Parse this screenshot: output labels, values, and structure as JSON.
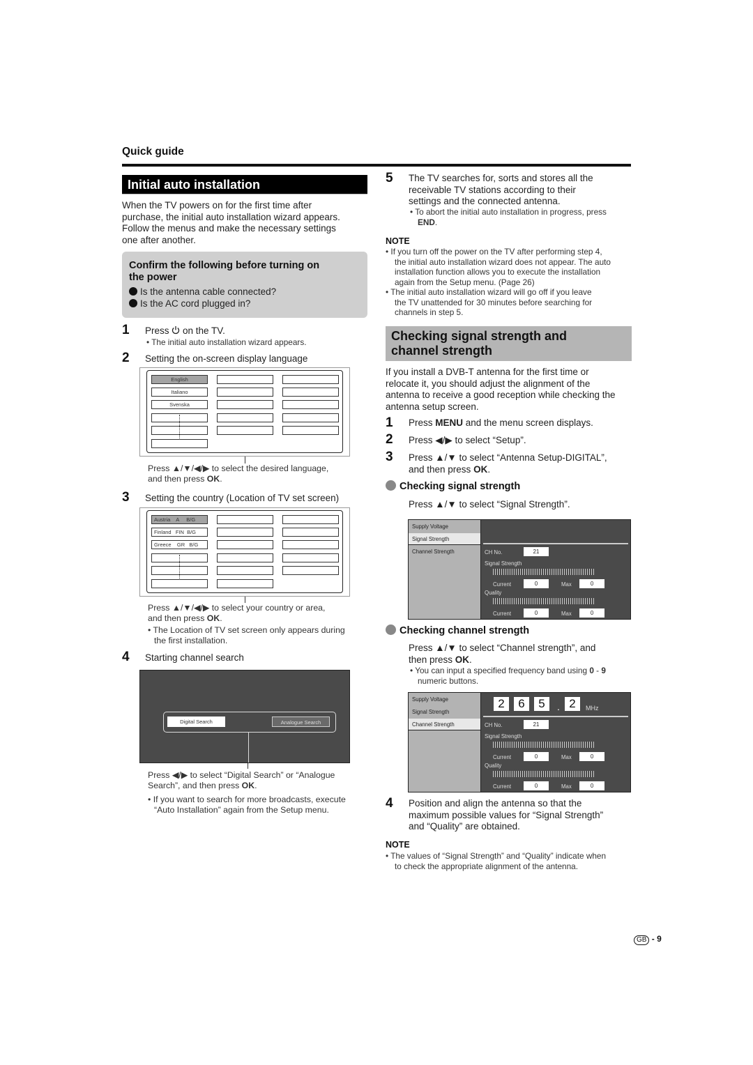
{
  "header": {
    "section": "Quick guide"
  },
  "left": {
    "title": "Initial auto installation",
    "intro": [
      "When the TV powers on for the first time after",
      "purchase, the initial auto installation wizard appears.",
      "Follow the menus and make the necessary settings",
      "one after another."
    ],
    "confirm_box": {
      "title_lines": [
        "Confirm the following  before turning on",
        "the power"
      ],
      "items": [
        "Is the antenna cable connected?",
        "Is the AC cord plugged in?"
      ]
    },
    "steps": [
      {
        "num": "1",
        "text_before": "Press ",
        "icon": "power-icon",
        "text_after": " on the TV.",
        "bullet": "The initial auto installation wizard appears."
      },
      {
        "num": "2",
        "text": "Setting the on-screen display language",
        "languages": [
          "English",
          "Italiano",
          "Svenska"
        ],
        "caption_line1": "Press ▲/▼/◀/▶ to select the desired language,",
        "caption_line2_pre": "and then press ",
        "caption_line2_bold": "OK",
        "caption_line2_post": "."
      },
      {
        "num": "3",
        "text": "Setting the country (Location of TV set screen)",
        "countries": [
          "Austria    A     B/G",
          "Finland   FIN  B/G",
          "Greece    GR   B/G"
        ],
        "caption_line1": "Press ▲/▼/◀/▶ to select your country or area,",
        "caption_line2_pre": "and then press ",
        "caption_line2_bold": "OK",
        "caption_line2_post": ".",
        "bullet_lines": [
          "The Location of TV set screen only appears during",
          "the first installation."
        ]
      },
      {
        "num": "4",
        "text": "Starting channel search",
        "buttons": {
          "digital": "Digital Search",
          "analogue": "Analogue Search"
        },
        "caption_line1": "Press ◀/▶ to select “Digital Search” or “Analogue",
        "caption_line2_pre": "Search”, and then press ",
        "caption_line2_bold": "OK",
        "caption_line2_post": ".",
        "bullet_lines": [
          "If you want to search for more broadcasts, execute",
          "“Auto Installation” again from the Setup menu."
        ]
      }
    ]
  },
  "right": {
    "step5": {
      "num": "5",
      "lines": [
        "The TV searches for, sorts and stores all the",
        "receivable TV stations according to their",
        "settings and the connected antenna."
      ],
      "bullet_line1": "To abort the initial auto installation in progress, press",
      "bullet_bold": "END",
      "bullet_post": "."
    },
    "note1": {
      "heading": "NOTE",
      "bullets": [
        [
          "If you turn off the power on the TV after performing step 4,",
          "the initial auto installation wizard does not appear. The auto",
          "installation function allows you to execute the installation",
          "again from the Setup menu. (Page 26)"
        ],
        [
          "The initial auto installation wizard will go off if you leave",
          "the TV unattended for 30 minutes before searching for",
          "channels in step 5."
        ]
      ]
    },
    "section2": {
      "title_lines": [
        "Checking signal strength and",
        "channel strength"
      ],
      "intro": [
        "If you install a DVB-T antenna for the first time or",
        "relocate it, you should adjust the alignment of the",
        "antenna to receive a good reception while checking the",
        "antenna setup screen."
      ],
      "steps": [
        {
          "num": "1",
          "pre": "Press ",
          "bold": "MENU",
          "post": " and the menu screen displays."
        },
        {
          "num": "2",
          "pre": "Press ◀/▶ to select “Setup”.",
          "bold": "",
          "post": ""
        },
        {
          "num": "3",
          "pre": "Press ▲/▼ to select “Antenna Setup-DIGITAL”,",
          "line2_pre": "and then press ",
          "line2_bold": "OK",
          "line2_post": "."
        }
      ],
      "signal": {
        "heading": "Checking signal strength",
        "instruction": "Press ▲/▼ to select “Signal Strength”."
      },
      "channel": {
        "heading": "Checking channel strength",
        "line1": "Press ▲/▼ to select “Channel strength”, and",
        "line2_pre": "then press ",
        "line2_bold": "OK",
        "line2_post": ".",
        "bullet_pre": "You can input a specified frequency band using ",
        "bullet_bold1": "0",
        "bullet_mid": " - ",
        "bullet_bold2": "9",
        "bullet_line2": "numeric buttons."
      },
      "panel": {
        "menu": [
          "Supply Voltage",
          "Signal Strength",
          "Channel Strength"
        ],
        "ch_label": "CH No.",
        "ch_value": "21",
        "signal_label": "Signal Strength",
        "quality_label": "Quality",
        "current_label": "Current",
        "max_label": "Max",
        "signal_current": "0",
        "signal_max": "0",
        "quality_current": "0",
        "quality_max": "0",
        "freq_digits": [
          "2",
          "6",
          "5",
          "2"
        ],
        "freq_dot": ".",
        "freq_unit": "MHz"
      },
      "step4": {
        "num": "4",
        "lines": [
          "Position and align the antenna so that the",
          "maximum possible values for “Signal Strength”",
          "and “Quality” are obtained."
        ]
      },
      "note2": {
        "heading": "NOTE",
        "lines": [
          "The values of “Signal Strength” and “Quality” indicate when",
          "to check the appropriate alignment of the antenna."
        ]
      }
    }
  },
  "footer": {
    "region": "GB",
    "page": "- 9"
  }
}
